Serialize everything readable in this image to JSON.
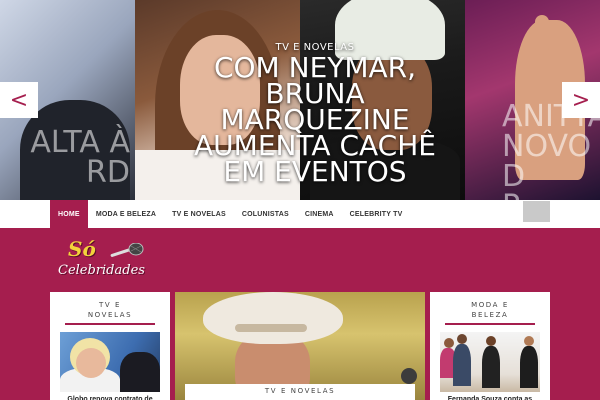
{
  "slider": {
    "left_slide_title": "ALTA À\nRD",
    "right_slide_title": "ANITTA\nNOVO D\nP",
    "caption_category": "TV E NOVELAS",
    "caption_title": "COM NEYMAR, BRUNA MARQUEZINE AUMENTA CACHÊ EM EVENTOS",
    "prev_label": "<",
    "next_label": ">"
  },
  "nav": {
    "items": [
      {
        "label": "HOME",
        "active": true
      },
      {
        "label": "MODA E BELEZA"
      },
      {
        "label": "TV E NOVELAS"
      },
      {
        "label": "COLUNISTAS"
      },
      {
        "label": "CINEMA"
      },
      {
        "label": "CELEBRITY TV"
      }
    ]
  },
  "logo": {
    "line1": "Só",
    "line2": "Celebridades"
  },
  "cards": {
    "left": {
      "category_line1": "TV E",
      "category_line2": "NOVELAS",
      "title": "Globo renova contrato de"
    },
    "featured": {
      "category": "TV E NOVELAS"
    },
    "right": {
      "category_line1": "MODA E",
      "category_line2": "BELEZA",
      "title": "Fernanda Souza conta as"
    }
  },
  "colors": {
    "accent": "#a51e4e",
    "nav_active": "#a51e4e",
    "logo_yellow": "#f3d33b"
  }
}
